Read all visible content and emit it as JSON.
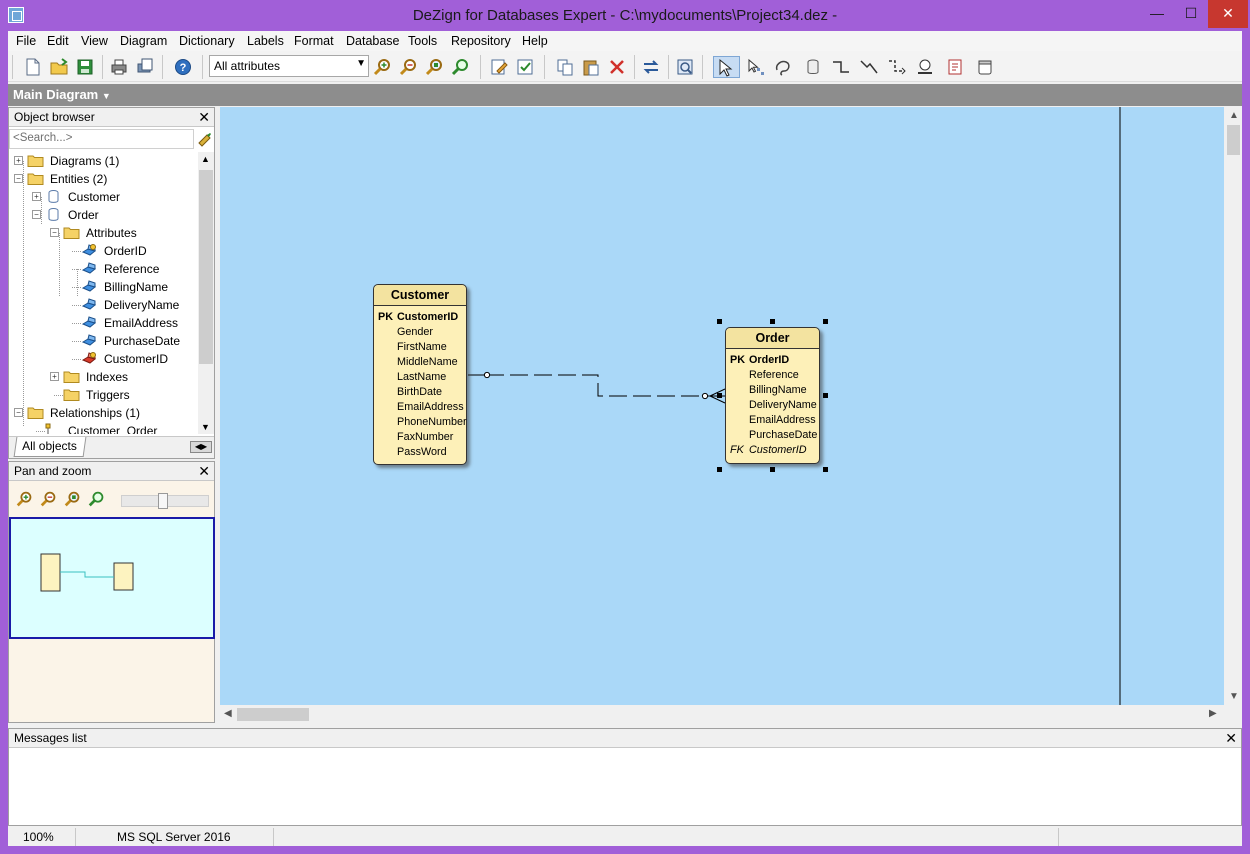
{
  "window": {
    "title": "DeZign for Databases Expert - C:\\mydocuments\\Project34.dez -"
  },
  "menu": [
    "File",
    "Edit",
    "View",
    "Diagram",
    "Dictionary",
    "Labels",
    "Format",
    "Database",
    "Tools",
    "Repository",
    "Help"
  ],
  "toolbar": {
    "attribute_filter": "All attributes",
    "icons": [
      "new-file-icon",
      "open-folder-icon",
      "save-icon",
      "print-icon",
      "print-preview-icon",
      "help-icon",
      "zoom-in-icon",
      "zoom-out-icon",
      "zoom-fit-icon",
      "zoom-100-icon",
      "edit-icon",
      "check-icon",
      "copy-icon",
      "paste-icon",
      "delete-icon",
      "swap-icon",
      "export-image-icon",
      "select-pointer-icon",
      "multi-select-icon",
      "lasso-icon",
      "entity-tool-icon",
      "relationship-tool-icon",
      "identifying-relationship-tool-icon",
      "nonidentifying-relationship-tool-icon",
      "subtype-tool-icon",
      "note-tool-icon",
      "area-tool-icon"
    ]
  },
  "diagram_tab": "Main Diagram",
  "object_browser": {
    "title": "Object browser",
    "search_placeholder": "<Search...>",
    "tree": [
      {
        "label": "Diagrams (1)",
        "depth": 0,
        "icon": "folder-icon",
        "expander": "+"
      },
      {
        "label": "Entities (2)",
        "depth": 0,
        "icon": "folder-icon",
        "expander": "-"
      },
      {
        "label": "Customer",
        "depth": 1,
        "icon": "entity-icon",
        "expander": "+"
      },
      {
        "label": "Order",
        "depth": 1,
        "icon": "entity-icon",
        "expander": "-"
      },
      {
        "label": "Attributes",
        "depth": 2,
        "icon": "folder-icon",
        "expander": "-"
      },
      {
        "label": "OrderID",
        "depth": 3,
        "icon": "primary-key-attribute-icon",
        "expander": ""
      },
      {
        "label": "Reference",
        "depth": 3,
        "icon": "attribute-icon",
        "expander": ""
      },
      {
        "label": "BillingName",
        "depth": 3,
        "icon": "attribute-icon",
        "expander": ""
      },
      {
        "label": "DeliveryName",
        "depth": 3,
        "icon": "attribute-icon",
        "expander": ""
      },
      {
        "label": "EmailAddress",
        "depth": 3,
        "icon": "attribute-icon",
        "expander": ""
      },
      {
        "label": "PurchaseDate",
        "depth": 3,
        "icon": "attribute-icon",
        "expander": ""
      },
      {
        "label": "CustomerID",
        "depth": 3,
        "icon": "foreign-key-attribute-icon",
        "expander": ""
      },
      {
        "label": "Indexes",
        "depth": 2,
        "icon": "folder-icon",
        "expander": "+"
      },
      {
        "label": "Triggers",
        "depth": 2,
        "icon": "folder-icon",
        "expander": ""
      },
      {
        "label": "Relationships (1)",
        "depth": 0,
        "icon": "folder-icon",
        "expander": "-"
      },
      {
        "label": "Customer_Order",
        "depth": 1,
        "icon": "relationship-icon",
        "expander": ""
      }
    ],
    "tab_label": "All objects"
  },
  "pan_zoom": {
    "title": "Pan and zoom",
    "slider_value": 0.5
  },
  "entities": [
    {
      "name": "Customer",
      "attributes": [
        {
          "key": "PK",
          "name": "CustomerID",
          "kind": "pk"
        },
        {
          "key": "",
          "name": "Gender",
          "kind": ""
        },
        {
          "key": "",
          "name": "FirstName",
          "kind": ""
        },
        {
          "key": "",
          "name": "MiddleName",
          "kind": ""
        },
        {
          "key": "",
          "name": "LastName",
          "kind": ""
        },
        {
          "key": "",
          "name": "BirthDate",
          "kind": ""
        },
        {
          "key": "",
          "name": "EmailAddress",
          "kind": ""
        },
        {
          "key": "",
          "name": "PhoneNumber",
          "kind": ""
        },
        {
          "key": "",
          "name": "FaxNumber",
          "kind": ""
        },
        {
          "key": "",
          "name": "PassWord",
          "kind": ""
        }
      ]
    },
    {
      "name": "Order",
      "selected": true,
      "attributes": [
        {
          "key": "PK",
          "name": "OrderID",
          "kind": "pk"
        },
        {
          "key": "",
          "name": "Reference",
          "kind": ""
        },
        {
          "key": "",
          "name": "BillingName",
          "kind": ""
        },
        {
          "key": "",
          "name": "DeliveryName",
          "kind": ""
        },
        {
          "key": "",
          "name": "EmailAddress",
          "kind": ""
        },
        {
          "key": "",
          "name": "PurchaseDate",
          "kind": ""
        },
        {
          "key": "FK",
          "name": "CustomerID",
          "kind": "fk"
        }
      ]
    }
  ],
  "messages": {
    "title": "Messages list"
  },
  "status": {
    "zoom": "100%",
    "dbms": "MS SQL Server 2016"
  },
  "colors": {
    "canvas": "#aad8f8",
    "entity_fill": "#fdf0b8",
    "titlebar": "#a15fd8",
    "pan_zoom_view": "#dcffff"
  }
}
